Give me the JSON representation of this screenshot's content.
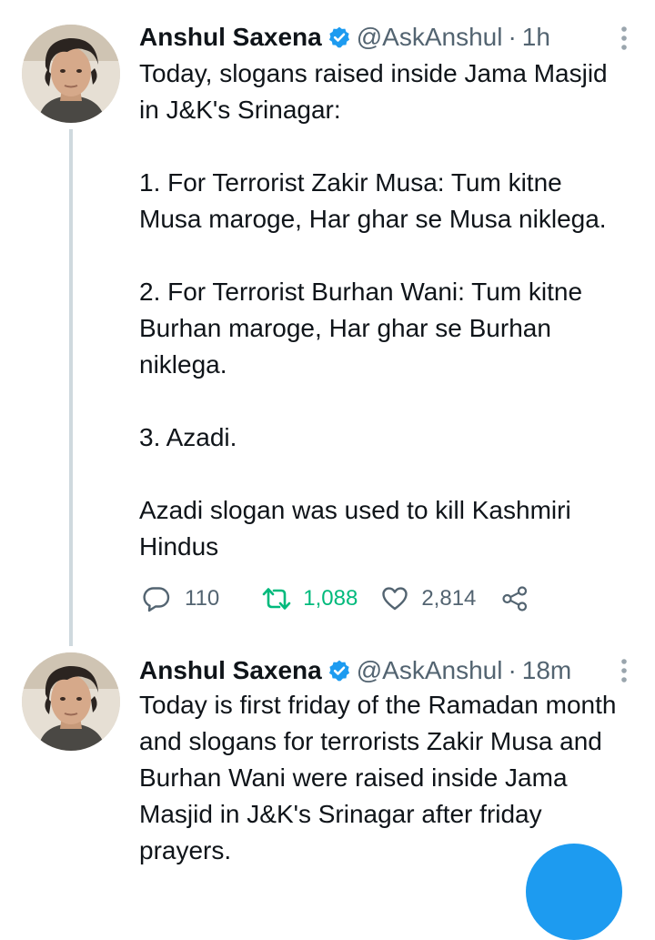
{
  "tweets": [
    {
      "author": {
        "name": "Anshul Saxena",
        "handle": "@AskAnshul",
        "verified": true
      },
      "separator": "·",
      "time": "1h",
      "paragraphs": [
        "Today, slogans raised inside Jama Masjid in J&K's Srinagar:",
        "1. For Terrorist Zakir Musa: Tum kitne Musa maroge, Har ghar se Musa niklega.",
        "2. For Terrorist Burhan Wani: Tum kitne Burhan maroge, Har ghar se Burhan niklega.",
        "3. Azadi.",
        "Azadi slogan was used to kill Kashmiri Hindus"
      ],
      "stats": {
        "replies": "110",
        "retweets": "1,088",
        "likes": "2,814"
      }
    },
    {
      "author": {
        "name": "Anshul Saxena",
        "handle": "@AskAnshul",
        "verified": true
      },
      "separator": "·",
      "time": "18m",
      "paragraphs": [
        "Today is first friday of the Ramadan month and slogans for terrorists Zakir Musa and Burhan Wani were raised inside Jama Masjid in J&K's Srinagar after friday prayers."
      ]
    }
  ],
  "colors": {
    "verified": "#1d9bf0",
    "secondary_text": "#536471",
    "retweet_active": "#00ba7c",
    "thread_line": "#cfd9de",
    "fab": "#1d9bf0"
  },
  "icons": {
    "verified": "verified-badge-icon",
    "more": "more-vertical-icon",
    "reply": "reply-bubble-icon",
    "retweet": "retweet-icon",
    "like": "heart-icon",
    "share": "share-icon"
  }
}
